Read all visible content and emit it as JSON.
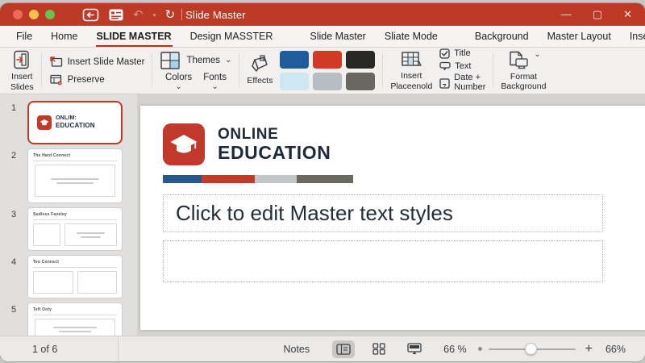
{
  "window": {
    "title": "Slide Master",
    "minimize": "—",
    "maximize": "▢",
    "close": "✕"
  },
  "icons": {
    "undo": "↶",
    "redo": "↻",
    "chevron": "⌄",
    "tab_chevron": "⌄"
  },
  "tabs": [
    {
      "label": "File"
    },
    {
      "label": "Home"
    },
    {
      "label": "SLIDE MASTER",
      "active": true
    },
    {
      "label": "Design MASSTER"
    },
    {
      "label": "Slide Master"
    },
    {
      "label": "Sliate Mode"
    },
    {
      "label": "Background"
    },
    {
      "label": "Master Layout"
    },
    {
      "label": "Insert"
    }
  ],
  "ribbon": {
    "insert_slides_line1": "Insert",
    "insert_slides_line2": "Slides",
    "insert_slide_master": "Insert Slide Master",
    "preserve": "Preserve",
    "themes": "Themes",
    "colors": "Colors",
    "fonts": "Fonts",
    "effects": "Effects",
    "swatches": [
      "#1f5c9e",
      "#d23a28",
      "#272725",
      "#cfe7f3",
      "#b7bec3",
      "#67675f"
    ],
    "insert_placeholder_line1": "Insert",
    "insert_placeholder_line2": "Placeenold",
    "title_toggle": "Title",
    "text_toggle": "Text",
    "date_toggle_line1": "Date +",
    "date_toggle_line2": "Number",
    "format_background_line1": "Format",
    "format_background_line2": "Background"
  },
  "thumbnails": {
    "selected_logo_line1": "ONLIM:",
    "selected_logo_line2": "EDUCATION",
    "items": [
      {
        "num": "1",
        "title": ""
      },
      {
        "num": "2",
        "title": "The Hard Connect"
      },
      {
        "num": "3",
        "title": "Sudless Faveley"
      },
      {
        "num": "4",
        "title": "Teo Connect"
      },
      {
        "num": "5",
        "title": "Teft Only"
      }
    ]
  },
  "slide": {
    "logo_line1": "ONLINE",
    "logo_line2": "EDUCATION",
    "bar_colors": [
      "#27578c",
      "#c23b27",
      "#c4c6c8",
      "#6a695e"
    ],
    "body_placeholder": "Click to edit Master text styles"
  },
  "statusbar": {
    "page": "1 of 6",
    "notes": "Notes",
    "zoom_value": "66 %",
    "plus": "+",
    "zoom_pct": "66%"
  },
  "colors": {
    "titlebar_red": "#bd3a26",
    "accent_red": "#b5301e",
    "logo_red": "#c0392b",
    "logo_navy": "#1e2a3a"
  }
}
